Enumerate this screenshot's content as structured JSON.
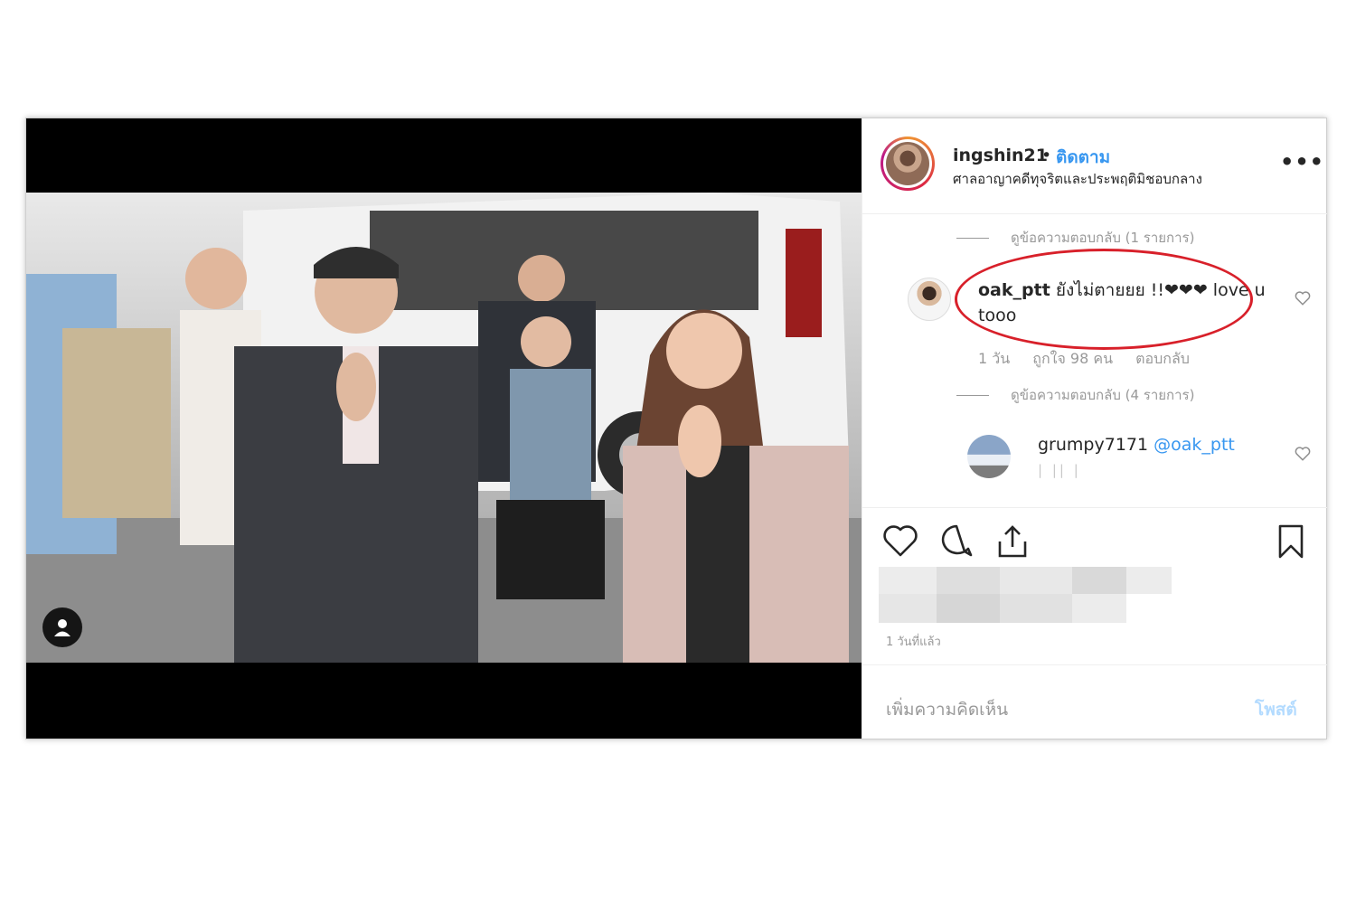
{
  "post": {
    "username": "ingshin21",
    "separator": "•",
    "follow_label": "ติดตาม",
    "location": "ศาลอาญาคดีทุจริตและประพฤติมิชอบกลาง",
    "more_icon": "more-options-icon"
  },
  "comments": {
    "view_replies_1": "ดูข้อความตอบกลับ (1 รายการ)",
    "comment_1": {
      "user": "oak_ptt",
      "text": " ยังไม่ตายยย !!❤❤❤ love u tooo",
      "age": "1 วัน",
      "likes": "ถูกใจ 98 คน",
      "reply_label": "ตอบกลับ"
    },
    "view_replies_2": "ดูข้อความตอบกลับ (4 รายการ)",
    "reply_1": {
      "user": "grumpy7171",
      "mention": "@oak_ptt",
      "faded_text": "| || |"
    }
  },
  "footer": {
    "timestamp": "1 วันที่แล้ว",
    "add_comment_placeholder": "เพิ่มความคิดเห็น",
    "post_label": "โพสต์"
  },
  "colors": {
    "link": "#3897f0",
    "highlight_circle": "#d8202a"
  }
}
